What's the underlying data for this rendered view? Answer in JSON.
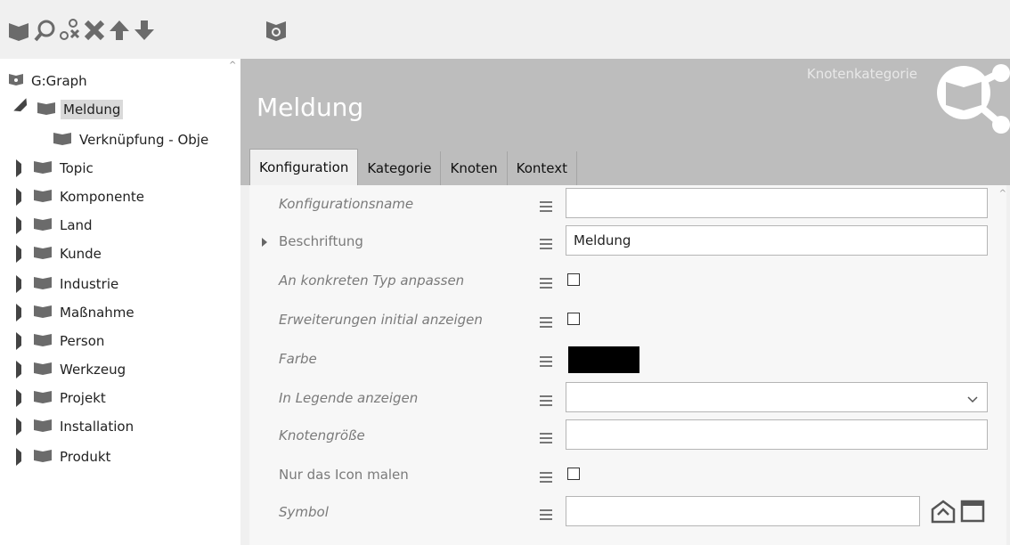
{
  "toolbar": {
    "buttons": [
      {
        "icon": "folder-icon"
      },
      {
        "icon": "search-icon"
      },
      {
        "icon": "nodes-icon"
      },
      {
        "icon": "delete-icon"
      },
      {
        "icon": "arrow-up-icon"
      },
      {
        "icon": "arrow-down-icon"
      },
      {
        "icon": "graph-settings-icon"
      }
    ]
  },
  "tree": {
    "root": "G:Graph",
    "items": [
      {
        "label": "Meldung",
        "expanded": true,
        "selected": true
      },
      {
        "label": "Verknüpfung - Obje",
        "child": true
      },
      {
        "label": "Topic"
      },
      {
        "label": "Komponente"
      },
      {
        "label": "Land"
      },
      {
        "label": "Kunde"
      },
      {
        "label": "Industrie"
      },
      {
        "label": "Maßnahme"
      },
      {
        "label": "Person"
      },
      {
        "label": "Werkzeug"
      },
      {
        "label": "Projekt"
      },
      {
        "label": "Installation"
      },
      {
        "label": "Produkt"
      }
    ]
  },
  "panel": {
    "title": "Meldung",
    "subtitle": "Knotenkategorie",
    "tabs": [
      "Konfiguration",
      "Kategorie",
      "Knoten",
      "Kontext"
    ],
    "active_tab": "Konfiguration"
  },
  "form": {
    "fields": [
      {
        "label": "Konfigurationsname",
        "type": "text",
        "value": ""
      },
      {
        "label": "Beschriftung",
        "type": "text",
        "value": "Meldung",
        "expandable": true
      },
      {
        "label": "An konkreten Typ anpassen",
        "type": "checkbox",
        "checked": false
      },
      {
        "label": "Erweiterungen initial anzeigen",
        "type": "checkbox",
        "checked": false
      },
      {
        "label": "Farbe",
        "type": "color",
        "value": "#000000"
      },
      {
        "label": "In Legende anzeigen",
        "type": "select",
        "value": ""
      },
      {
        "label": "Knotengröße",
        "type": "text",
        "value": ""
      },
      {
        "label": "Nur das Icon malen",
        "type": "checkbox",
        "checked": false
      },
      {
        "label": "Symbol",
        "type": "text",
        "value": ""
      }
    ]
  },
  "colors": {
    "folder": "#6b6b6b",
    "header": "#bdbdbd",
    "selected": "#d9d9d9"
  }
}
